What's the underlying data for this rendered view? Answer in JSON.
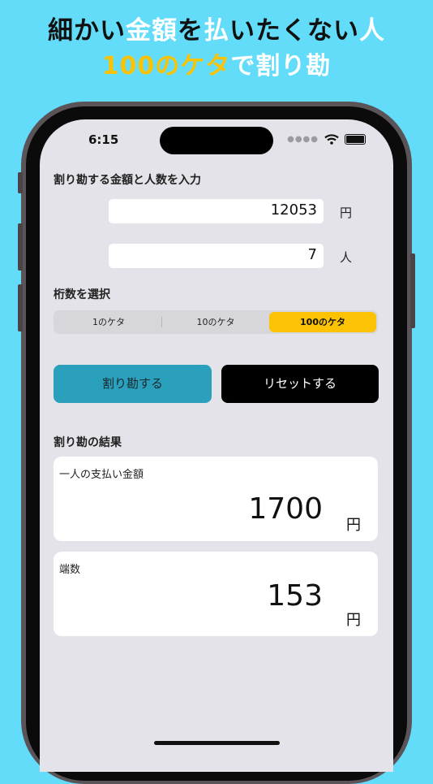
{
  "headline": {
    "line1": [
      {
        "text": "細かい",
        "tone": "dark"
      },
      {
        "text": "金額",
        "tone": "white"
      },
      {
        "text": "を",
        "tone": "dark"
      },
      {
        "text": "払",
        "tone": "white"
      },
      {
        "text": "いたくない",
        "tone": "dark"
      },
      {
        "text": "人",
        "tone": "white"
      }
    ],
    "line2": [
      {
        "text": "100のケタ",
        "tone": "gold"
      },
      {
        "text": "で割り勘",
        "tone": "white"
      }
    ]
  },
  "status_bar": {
    "time": "6:15"
  },
  "form": {
    "section_label": "割り勘する金額と人数を入力",
    "amount": {
      "value": "12053",
      "unit": "円"
    },
    "people": {
      "value": "7",
      "unit": "人"
    }
  },
  "digits": {
    "section_label": "桁数を選択",
    "options": [
      "1のケタ",
      "10のケタ",
      "100のケタ"
    ],
    "selected_index": 2
  },
  "actions": {
    "calculate_label": "割り勘する",
    "reset_label": "リセットする"
  },
  "result": {
    "section_label": "割り勘の結果",
    "per_person": {
      "label": "一人の支払い金額",
      "value": "1700",
      "unit": "円"
    },
    "remainder": {
      "label": "端数",
      "value": "153",
      "unit": "円"
    }
  },
  "colors": {
    "background": "#62dcf9",
    "accent_gold": "#fbc304",
    "calculate_button": "#2aa0bd",
    "reset_button": "#000000"
  }
}
